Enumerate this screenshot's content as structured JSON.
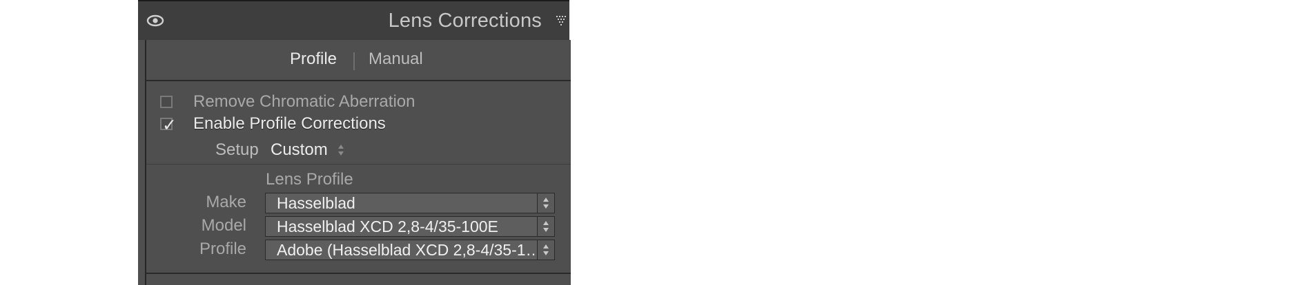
{
  "panel": {
    "title": "Lens Corrections",
    "visibility_icon": "eye-icon",
    "collapse_icon": "triangle-down-icon"
  },
  "tabs": [
    {
      "label": "Profile",
      "active": true
    },
    {
      "label": "Manual",
      "active": false
    }
  ],
  "options": {
    "remove_ca": {
      "label": "Remove Chromatic Aberration",
      "checked": false
    },
    "enable_profile": {
      "label": "Enable Profile Corrections",
      "checked": true
    }
  },
  "setup": {
    "label": "Setup",
    "value": "Custom"
  },
  "lens_profile": {
    "title": "Lens Profile",
    "make": {
      "label": "Make",
      "value": "Hasselblad"
    },
    "model": {
      "label": "Model",
      "value": "Hasselblad XCD 2,8-4/35-100E"
    },
    "profile": {
      "label": "Profile",
      "value": "Adobe (Hasselblad XCD 2,8-4/35-1…"
    }
  },
  "colors": {
    "panel_bg": "#4f4f4f",
    "header_bg": "#3e3e3e",
    "text_bright": "#ececec",
    "text_dim": "#a9a9a9"
  }
}
